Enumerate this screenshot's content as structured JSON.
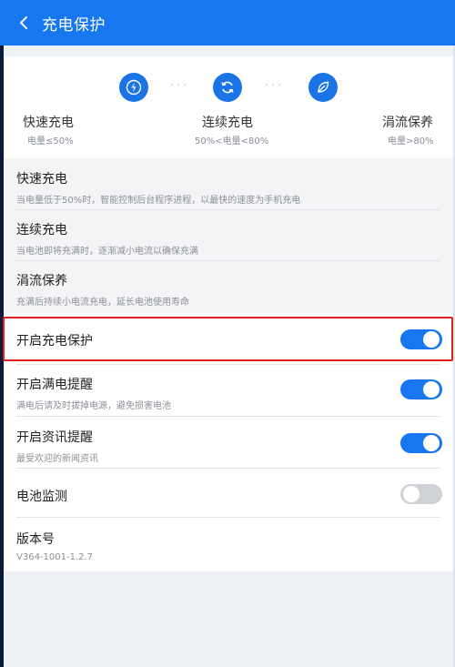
{
  "header": {
    "title": "充电保护"
  },
  "modes": [
    {
      "name": "快速充电",
      "range": "电量≤50%",
      "icon": "lightning-icon"
    },
    {
      "name": "连续充电",
      "range": "50%<电量<80%",
      "icon": "refresh-icon"
    },
    {
      "name": "涓流保养",
      "range": "电量>80%",
      "icon": "leaf-icon"
    }
  ],
  "info_rows": [
    {
      "title": "快速充电",
      "desc": "当电量低于50%时，智能控制后台程序进程，以最快的速度为手机充电"
    },
    {
      "title": "连续充电",
      "desc": "当电池即将充满时，逐渐减小电流以确保充满"
    },
    {
      "title": "涓流保养",
      "desc": "充满后持续小电流充电，延长电池使用寿命"
    }
  ],
  "settings": [
    {
      "title": "开启充电保护",
      "desc": "",
      "toggle": "on"
    },
    {
      "title": "开启满电提醒",
      "desc": "满电后请及时拔掉电源，避免损害电池",
      "toggle": "on"
    },
    {
      "title": "开启资讯提醒",
      "desc": "最受欢迎的新闻资讯",
      "toggle": "on"
    },
    {
      "title": "电池监测",
      "desc": "",
      "toggle": "off"
    },
    {
      "title": "版本号",
      "desc": "V364-1001-1.2.7",
      "toggle": null
    }
  ],
  "colors": {
    "accent": "#1677f0",
    "highlight": "#e02020"
  }
}
